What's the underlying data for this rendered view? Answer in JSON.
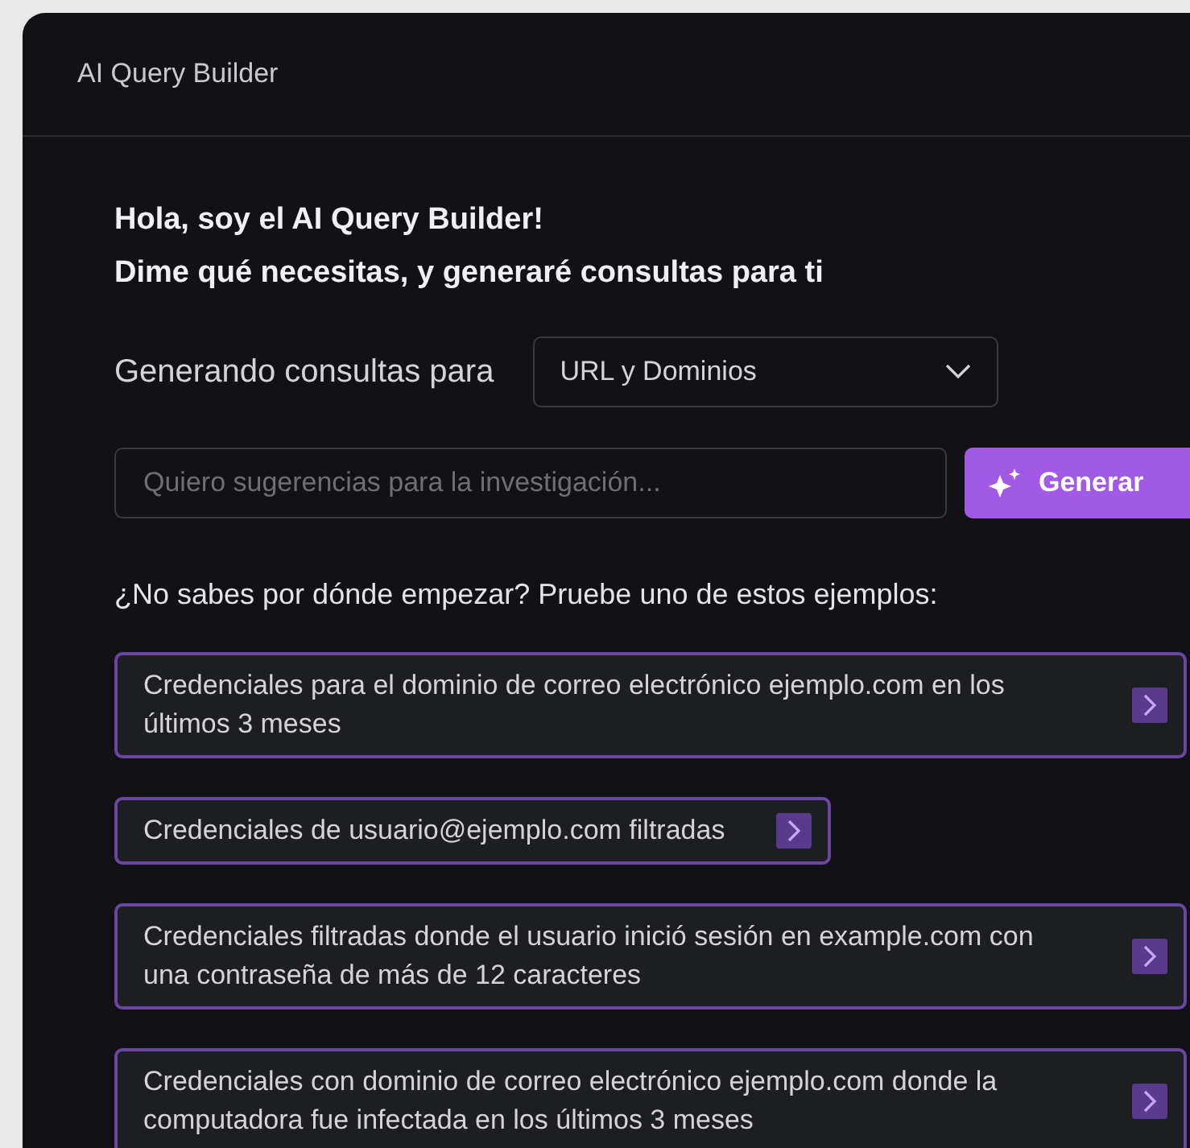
{
  "window": {
    "title": "AI Query Builder"
  },
  "greeting": [
    "Hola, soy el AI Query Builder!",
    "Dime qué necesitas, y generaré consultas para ti"
  ],
  "target": {
    "label": "Generando consultas para",
    "value": "URL y Dominios"
  },
  "query": {
    "placeholder": "Quiero sugerencias para la investigación...",
    "button": "Generar"
  },
  "examples_hint": "¿No sabes por dónde empezar? Pruebe uno de estos ejemplos:",
  "examples": [
    {
      "text": "Credenciales para el dominio de correo electrónico ejemplo.com en los últimos 3 meses"
    },
    {
      "text": "Credenciales de usuario@ejemplo.com filtradas"
    },
    {
      "text": "Credenciales filtradas donde el usuario inició sesión en example.com con una contraseña de más de 12 caracteres"
    },
    {
      "text": "Credenciales con dominio de correo electrónico ejemplo.com donde la computadora fue infectada en los últimos 3 meses"
    }
  ]
}
